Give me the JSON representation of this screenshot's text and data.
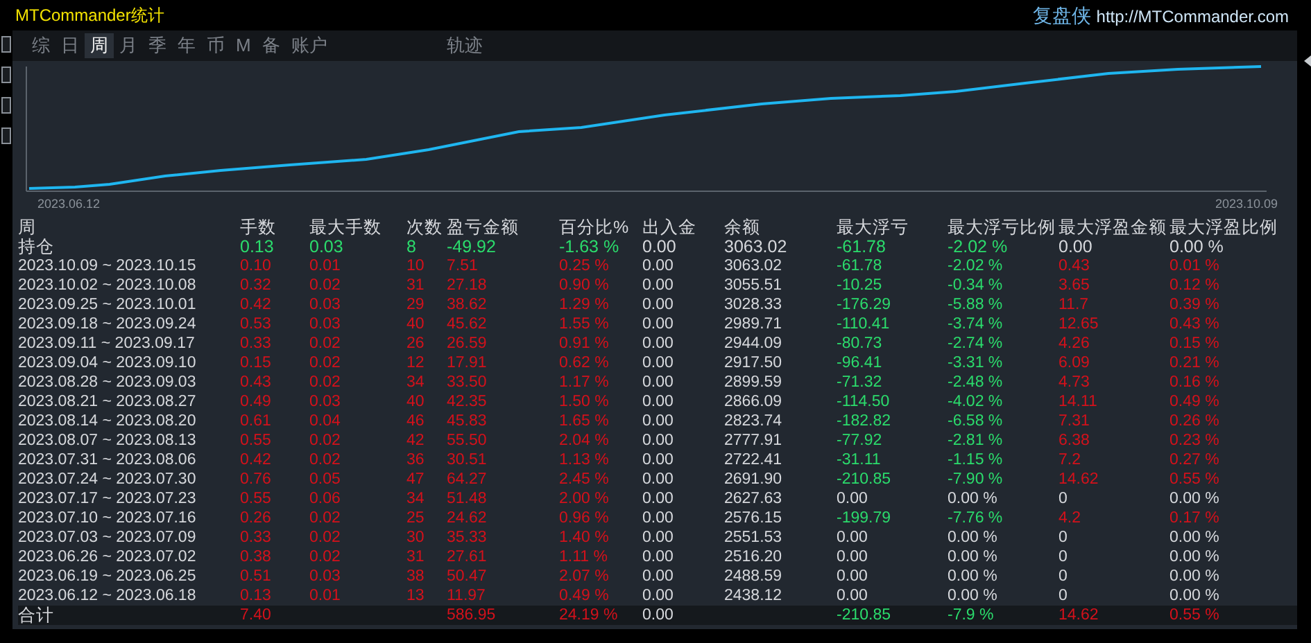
{
  "window": {
    "title": "MTCommander统计",
    "brand": "复盘侠",
    "url": "http://MTCommander.com"
  },
  "tabs": [
    {
      "label": "综",
      "selected": false
    },
    {
      "label": "日",
      "selected": false
    },
    {
      "label": "周",
      "selected": true
    },
    {
      "label": "月",
      "selected": false
    },
    {
      "label": "季",
      "selected": false
    },
    {
      "label": "年",
      "selected": false
    },
    {
      "label": "币",
      "selected": false
    },
    {
      "label": "M",
      "selected": false
    },
    {
      "label": "备",
      "selected": false
    },
    {
      "label": "账户",
      "selected": false
    },
    {
      "label": "轨迹",
      "selected": false
    }
  ],
  "chart": {
    "start_label": "2023.06.12",
    "end_label": "2023.10.09"
  },
  "table": {
    "columns": [
      "周",
      "手数",
      "最大手数",
      "次数",
      "盈亏金额",
      "百分比%",
      "出入金",
      "余额",
      "最大浮亏",
      "最大浮亏比例",
      "最大浮盈金额",
      "最大浮盈比例"
    ],
    "rows": [
      {
        "kind": "open",
        "cells": [
          {
            "text": "持仓"
          },
          {
            "text": "0.13",
            "color": "#2bdc6c"
          },
          {
            "text": "0.03",
            "color": "#2bdc6c"
          },
          {
            "text": "8",
            "color": "#2bdc6c"
          },
          {
            "text": "-49.92",
            "color": "#2bdc6c"
          },
          {
            "text": "-1.63 %",
            "color": "#2bdc6c"
          },
          {
            "text": "0.00"
          },
          {
            "text": "3063.02"
          },
          {
            "text": "-61.78",
            "color": "#2bdc6c"
          },
          {
            "text": "-2.02 %",
            "color": "#2bdc6c"
          },
          {
            "text": "0.00"
          },
          {
            "text": "0.00 %"
          }
        ]
      },
      {
        "kind": "week",
        "cells": [
          {
            "text": "2023.10.09 ~ 2023.10.15"
          },
          {
            "text": "0.10",
            "color": "#d4111b"
          },
          {
            "text": "0.01",
            "color": "#d4111b"
          },
          {
            "text": "10",
            "color": "#d4111b"
          },
          {
            "text": "7.51",
            "color": "#d4111b"
          },
          {
            "text": "0.25 %",
            "color": "#d4111b"
          },
          {
            "text": "0.00"
          },
          {
            "text": "3063.02"
          },
          {
            "text": "-61.78",
            "color": "#2bdc6c"
          },
          {
            "text": "-2.02 %",
            "color": "#2bdc6c"
          },
          {
            "text": "0.43",
            "color": "#d4111b"
          },
          {
            "text": "0.01 %",
            "color": "#d4111b"
          }
        ]
      },
      {
        "kind": "week",
        "cells": [
          {
            "text": "2023.10.02 ~ 2023.10.08"
          },
          {
            "text": "0.32",
            "color": "#d4111b"
          },
          {
            "text": "0.02",
            "color": "#d4111b"
          },
          {
            "text": "31",
            "color": "#d4111b"
          },
          {
            "text": "27.18",
            "color": "#d4111b"
          },
          {
            "text": "0.90 %",
            "color": "#d4111b"
          },
          {
            "text": "0.00"
          },
          {
            "text": "3055.51"
          },
          {
            "text": "-10.25",
            "color": "#2bdc6c"
          },
          {
            "text": "-0.34 %",
            "color": "#2bdc6c"
          },
          {
            "text": "3.65",
            "color": "#d4111b"
          },
          {
            "text": "0.12 %",
            "color": "#d4111b"
          }
        ]
      },
      {
        "kind": "week",
        "cells": [
          {
            "text": "2023.09.25 ~ 2023.10.01"
          },
          {
            "text": "0.42",
            "color": "#d4111b"
          },
          {
            "text": "0.03",
            "color": "#d4111b"
          },
          {
            "text": "29",
            "color": "#d4111b"
          },
          {
            "text": "38.62",
            "color": "#d4111b"
          },
          {
            "text": "1.29 %",
            "color": "#d4111b"
          },
          {
            "text": "0.00"
          },
          {
            "text": "3028.33"
          },
          {
            "text": "-176.29",
            "color": "#2bdc6c"
          },
          {
            "text": "-5.88 %",
            "color": "#2bdc6c"
          },
          {
            "text": "11.7",
            "color": "#d4111b"
          },
          {
            "text": "0.39 %",
            "color": "#d4111b"
          }
        ]
      },
      {
        "kind": "week",
        "cells": [
          {
            "text": "2023.09.18 ~ 2023.09.24"
          },
          {
            "text": "0.53",
            "color": "#d4111b"
          },
          {
            "text": "0.03",
            "color": "#d4111b"
          },
          {
            "text": "40",
            "color": "#d4111b"
          },
          {
            "text": "45.62",
            "color": "#d4111b"
          },
          {
            "text": "1.55 %",
            "color": "#d4111b"
          },
          {
            "text": "0.00"
          },
          {
            "text": "2989.71"
          },
          {
            "text": "-110.41",
            "color": "#2bdc6c"
          },
          {
            "text": "-3.74 %",
            "color": "#2bdc6c"
          },
          {
            "text": "12.65",
            "color": "#d4111b"
          },
          {
            "text": "0.43 %",
            "color": "#d4111b"
          }
        ]
      },
      {
        "kind": "week",
        "cells": [
          {
            "text": "2023.09.11 ~ 2023.09.17"
          },
          {
            "text": "0.33",
            "color": "#d4111b"
          },
          {
            "text": "0.02",
            "color": "#d4111b"
          },
          {
            "text": "26",
            "color": "#d4111b"
          },
          {
            "text": "26.59",
            "color": "#d4111b"
          },
          {
            "text": "0.91 %",
            "color": "#d4111b"
          },
          {
            "text": "0.00"
          },
          {
            "text": "2944.09"
          },
          {
            "text": "-80.73",
            "color": "#2bdc6c"
          },
          {
            "text": "-2.74 %",
            "color": "#2bdc6c"
          },
          {
            "text": "4.26",
            "color": "#d4111b"
          },
          {
            "text": "0.15 %",
            "color": "#d4111b"
          }
        ]
      },
      {
        "kind": "week",
        "cells": [
          {
            "text": "2023.09.04 ~ 2023.09.10"
          },
          {
            "text": "0.15",
            "color": "#d4111b"
          },
          {
            "text": "0.02",
            "color": "#d4111b"
          },
          {
            "text": "12",
            "color": "#d4111b"
          },
          {
            "text": "17.91",
            "color": "#d4111b"
          },
          {
            "text": "0.62 %",
            "color": "#d4111b"
          },
          {
            "text": "0.00"
          },
          {
            "text": "2917.50"
          },
          {
            "text": "-96.41",
            "color": "#2bdc6c"
          },
          {
            "text": "-3.31 %",
            "color": "#2bdc6c"
          },
          {
            "text": "6.09",
            "color": "#d4111b"
          },
          {
            "text": "0.21 %",
            "color": "#d4111b"
          }
        ]
      },
      {
        "kind": "week",
        "cells": [
          {
            "text": "2023.08.28 ~ 2023.09.03"
          },
          {
            "text": "0.43",
            "color": "#d4111b"
          },
          {
            "text": "0.02",
            "color": "#d4111b"
          },
          {
            "text": "34",
            "color": "#d4111b"
          },
          {
            "text": "33.50",
            "color": "#d4111b"
          },
          {
            "text": "1.17 %",
            "color": "#d4111b"
          },
          {
            "text": "0.00"
          },
          {
            "text": "2899.59"
          },
          {
            "text": "-71.32",
            "color": "#2bdc6c"
          },
          {
            "text": "-2.48 %",
            "color": "#2bdc6c"
          },
          {
            "text": "4.73",
            "color": "#d4111b"
          },
          {
            "text": "0.16 %",
            "color": "#d4111b"
          }
        ]
      },
      {
        "kind": "week",
        "cells": [
          {
            "text": "2023.08.21 ~ 2023.08.27"
          },
          {
            "text": "0.49",
            "color": "#d4111b"
          },
          {
            "text": "0.03",
            "color": "#d4111b"
          },
          {
            "text": "40",
            "color": "#d4111b"
          },
          {
            "text": "42.35",
            "color": "#d4111b"
          },
          {
            "text": "1.50 %",
            "color": "#d4111b"
          },
          {
            "text": "0.00"
          },
          {
            "text": "2866.09"
          },
          {
            "text": "-114.50",
            "color": "#2bdc6c"
          },
          {
            "text": "-4.02 %",
            "color": "#2bdc6c"
          },
          {
            "text": "14.11",
            "color": "#d4111b"
          },
          {
            "text": "0.49 %",
            "color": "#d4111b"
          }
        ]
      },
      {
        "kind": "week",
        "cells": [
          {
            "text": "2023.08.14 ~ 2023.08.20"
          },
          {
            "text": "0.61",
            "color": "#d4111b"
          },
          {
            "text": "0.04",
            "color": "#d4111b"
          },
          {
            "text": "46",
            "color": "#d4111b"
          },
          {
            "text": "45.83",
            "color": "#d4111b"
          },
          {
            "text": "1.65 %",
            "color": "#d4111b"
          },
          {
            "text": "0.00"
          },
          {
            "text": "2823.74"
          },
          {
            "text": "-182.82",
            "color": "#2bdc6c"
          },
          {
            "text": "-6.58 %",
            "color": "#2bdc6c"
          },
          {
            "text": "7.31",
            "color": "#d4111b"
          },
          {
            "text": "0.26 %",
            "color": "#d4111b"
          }
        ]
      },
      {
        "kind": "week",
        "cells": [
          {
            "text": "2023.08.07 ~ 2023.08.13"
          },
          {
            "text": "0.55",
            "color": "#d4111b"
          },
          {
            "text": "0.02",
            "color": "#d4111b"
          },
          {
            "text": "42",
            "color": "#d4111b"
          },
          {
            "text": "55.50",
            "color": "#d4111b"
          },
          {
            "text": "2.04 %",
            "color": "#d4111b"
          },
          {
            "text": "0.00"
          },
          {
            "text": "2777.91"
          },
          {
            "text": "-77.92",
            "color": "#2bdc6c"
          },
          {
            "text": "-2.81 %",
            "color": "#2bdc6c"
          },
          {
            "text": "6.38",
            "color": "#d4111b"
          },
          {
            "text": "0.23 %",
            "color": "#d4111b"
          }
        ]
      },
      {
        "kind": "week",
        "cells": [
          {
            "text": "2023.07.31 ~ 2023.08.06"
          },
          {
            "text": "0.42",
            "color": "#d4111b"
          },
          {
            "text": "0.02",
            "color": "#d4111b"
          },
          {
            "text": "36",
            "color": "#d4111b"
          },
          {
            "text": "30.51",
            "color": "#d4111b"
          },
          {
            "text": "1.13 %",
            "color": "#d4111b"
          },
          {
            "text": "0.00"
          },
          {
            "text": "2722.41"
          },
          {
            "text": "-31.11",
            "color": "#2bdc6c"
          },
          {
            "text": "-1.15 %",
            "color": "#2bdc6c"
          },
          {
            "text": "7.2",
            "color": "#d4111b"
          },
          {
            "text": "0.27 %",
            "color": "#d4111b"
          }
        ]
      },
      {
        "kind": "week",
        "cells": [
          {
            "text": "2023.07.24 ~ 2023.07.30"
          },
          {
            "text": "0.76",
            "color": "#d4111b"
          },
          {
            "text": "0.05",
            "color": "#d4111b"
          },
          {
            "text": "47",
            "color": "#d4111b"
          },
          {
            "text": "64.27",
            "color": "#d4111b"
          },
          {
            "text": "2.45 %",
            "color": "#d4111b"
          },
          {
            "text": "0.00"
          },
          {
            "text": "2691.90"
          },
          {
            "text": "-210.85",
            "color": "#2bdc6c"
          },
          {
            "text": "-7.90 %",
            "color": "#2bdc6c"
          },
          {
            "text": "14.62",
            "color": "#d4111b"
          },
          {
            "text": "0.55 %",
            "color": "#d4111b"
          }
        ]
      },
      {
        "kind": "week",
        "cells": [
          {
            "text": "2023.07.17 ~ 2023.07.23"
          },
          {
            "text": "0.55",
            "color": "#d4111b"
          },
          {
            "text": "0.06",
            "color": "#d4111b"
          },
          {
            "text": "34",
            "color": "#d4111b"
          },
          {
            "text": "51.48",
            "color": "#d4111b"
          },
          {
            "text": "2.00 %",
            "color": "#d4111b"
          },
          {
            "text": "0.00"
          },
          {
            "text": "2627.63"
          },
          {
            "text": "0.00"
          },
          {
            "text": "0.00 %"
          },
          {
            "text": "0"
          },
          {
            "text": "0.00 %"
          }
        ]
      },
      {
        "kind": "week",
        "cells": [
          {
            "text": "2023.07.10 ~ 2023.07.16"
          },
          {
            "text": "0.26",
            "color": "#d4111b"
          },
          {
            "text": "0.02",
            "color": "#d4111b"
          },
          {
            "text": "25",
            "color": "#d4111b"
          },
          {
            "text": "24.62",
            "color": "#d4111b"
          },
          {
            "text": "0.96 %",
            "color": "#d4111b"
          },
          {
            "text": "0.00"
          },
          {
            "text": "2576.15"
          },
          {
            "text": "-199.79",
            "color": "#2bdc6c"
          },
          {
            "text": "-7.76 %",
            "color": "#2bdc6c"
          },
          {
            "text": "4.2",
            "color": "#d4111b"
          },
          {
            "text": "0.17 %",
            "color": "#d4111b"
          }
        ]
      },
      {
        "kind": "week",
        "cells": [
          {
            "text": "2023.07.03 ~ 2023.07.09"
          },
          {
            "text": "0.33",
            "color": "#d4111b"
          },
          {
            "text": "0.02",
            "color": "#d4111b"
          },
          {
            "text": "30",
            "color": "#d4111b"
          },
          {
            "text": "35.33",
            "color": "#d4111b"
          },
          {
            "text": "1.40 %",
            "color": "#d4111b"
          },
          {
            "text": "0.00"
          },
          {
            "text": "2551.53"
          },
          {
            "text": "0.00"
          },
          {
            "text": "0.00 %"
          },
          {
            "text": "0"
          },
          {
            "text": "0.00 %"
          }
        ]
      },
      {
        "kind": "week",
        "cells": [
          {
            "text": "2023.06.26 ~ 2023.07.02"
          },
          {
            "text": "0.38",
            "color": "#d4111b"
          },
          {
            "text": "0.02",
            "color": "#d4111b"
          },
          {
            "text": "31",
            "color": "#d4111b"
          },
          {
            "text": "27.61",
            "color": "#d4111b"
          },
          {
            "text": "1.11 %",
            "color": "#d4111b"
          },
          {
            "text": "0.00"
          },
          {
            "text": "2516.20"
          },
          {
            "text": "0.00"
          },
          {
            "text": "0.00 %"
          },
          {
            "text": "0"
          },
          {
            "text": "0.00 %"
          }
        ]
      },
      {
        "kind": "week",
        "cells": [
          {
            "text": "2023.06.19 ~ 2023.06.25"
          },
          {
            "text": "0.51",
            "color": "#d4111b"
          },
          {
            "text": "0.03",
            "color": "#d4111b"
          },
          {
            "text": "38",
            "color": "#d4111b"
          },
          {
            "text": "50.47",
            "color": "#d4111b"
          },
          {
            "text": "2.07 %",
            "color": "#d4111b"
          },
          {
            "text": "0.00"
          },
          {
            "text": "2488.59"
          },
          {
            "text": "0.00"
          },
          {
            "text": "0.00 %"
          },
          {
            "text": "0"
          },
          {
            "text": "0.00 %"
          }
        ]
      },
      {
        "kind": "week",
        "cells": [
          {
            "text": "2023.06.12 ~ 2023.06.18"
          },
          {
            "text": "0.13",
            "color": "#d4111b"
          },
          {
            "text": "0.01",
            "color": "#d4111b"
          },
          {
            "text": "13",
            "color": "#d4111b"
          },
          {
            "text": "11.97",
            "color": "#d4111b"
          },
          {
            "text": "0.49 %",
            "color": "#d4111b"
          },
          {
            "text": "0.00"
          },
          {
            "text": "2438.12"
          },
          {
            "text": "0.00"
          },
          {
            "text": "0.00 %"
          },
          {
            "text": "0"
          },
          {
            "text": "0.00 %"
          }
        ]
      },
      {
        "kind": "total",
        "cells": [
          {
            "text": "合计"
          },
          {
            "text": "7.40",
            "color": "#d4111b"
          },
          null,
          null,
          {
            "text": "586.95",
            "color": "#d4111b"
          },
          {
            "text": "24.19 %",
            "color": "#d4111b"
          },
          {
            "text": "0.00"
          },
          null,
          {
            "text": "-210.85",
            "color": "#2bdc6c"
          },
          {
            "text": "-7.9 %",
            "color": "#2bdc6c"
          },
          {
            "text": "14.62",
            "color": "#d4111b"
          },
          {
            "text": "0.55 %",
            "color": "#d4111b"
          }
        ]
      }
    ]
  }
}
